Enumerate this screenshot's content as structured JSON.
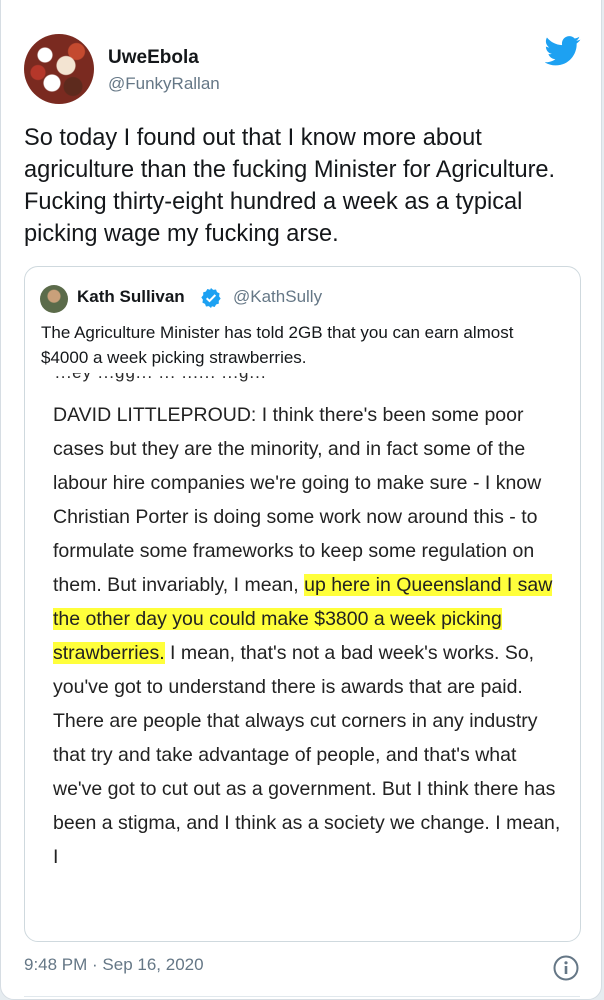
{
  "tweet": {
    "author_name": "UweEbola",
    "author_handle": "@FunkyRallan",
    "text": "So today I found out that I know more about agriculture than the fucking Minister for Agriculture. Fucking thirty-eight hundred a week as a typical picking wage my fucking arse.",
    "timestamp": "9:48 PM · Sep 16, 2020"
  },
  "quoted_tweet": {
    "author_name": "Kath Sullivan",
    "author_handle": "@KathSully",
    "text": "The Agriculture Minister has told 2GB that you can earn almost $4000 a week picking strawberries.",
    "image": {
      "cut_line": "...ey ...gg...  ...  ......  ...g...",
      "before_highlight": "DAVID LITTLEPROUD: I think there's been some poor cases but they are the minority, and in fact some of the labour hire companies we're going to make sure - I know Christian Porter is doing some work now around this - to formulate some frameworks to keep some regulation on them. But invariably, I mean, ",
      "highlight": "up here in Queensland I saw the other day you could make $3800 a week picking strawberries.",
      "after_highlight": " I mean, that's not a bad week's works. So, you've got to understand there is awards that are paid. There are people that always cut corners in any industry that try and take advantage of people, and that's what we've got to cut out as a government. But I think there has been a stigma, and I think as a society we change. I mean, I"
    }
  },
  "icons": {
    "brand": "twitter-bird-icon",
    "verified": "verified-badge-icon",
    "info": "info-icon",
    "brand_color": "#1da1f2",
    "highlight_color": "#ffff3b"
  }
}
